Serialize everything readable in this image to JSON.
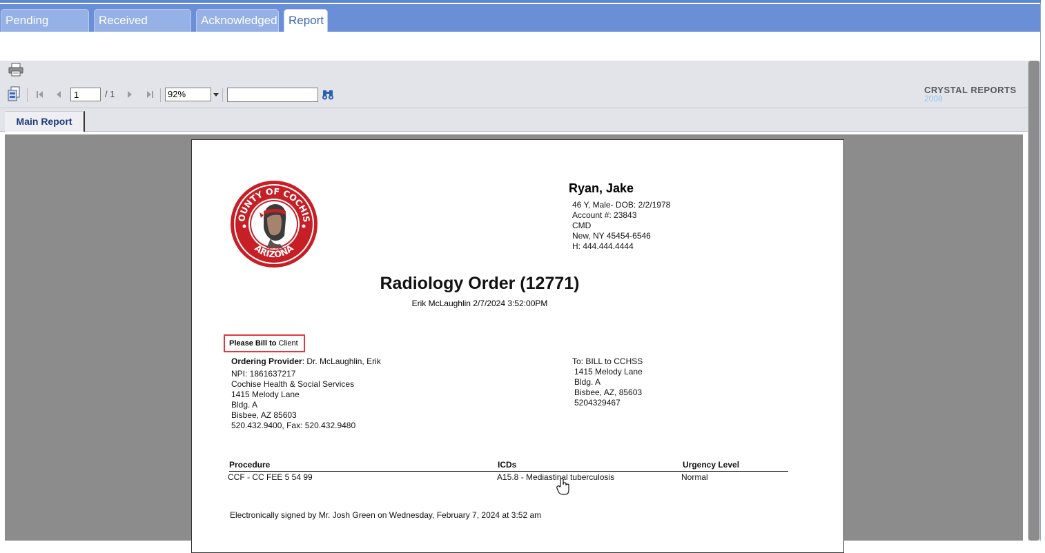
{
  "tabs": [
    {
      "label": "Pending Orders"
    },
    {
      "label": "Received Results"
    },
    {
      "label": "Acknowledged"
    },
    {
      "label": "Report"
    }
  ],
  "toolbar": {
    "page_value": "1",
    "page_total": "/ 1",
    "zoom": "92%",
    "search_value": "",
    "brand_name": "CRYSTAL REPORTS",
    "brand_year": "2008"
  },
  "report_tab": "Main Report",
  "logo_text": {
    "top": "COUNTY OF COCHISE",
    "bottom": "ARIZONA",
    "year": "1881"
  },
  "patient": {
    "name": "Ryan, Jake",
    "lines": [
      "46 Y, Male- DOB: 2/2/1978",
      "Account #: 23843",
      "CMD",
      "New,  NY 45454-6546",
      "H: 444.444.4444"
    ]
  },
  "order": {
    "title": "Radiology Order (12771)",
    "subtitle": "Erik McLaughlin 2/7/2024   3:52:00PM",
    "bill_bold": "Please Bill to",
    "bill_text": "Client"
  },
  "provider": {
    "label": "Ordering Provider",
    "name": ": Dr. McLaughlin, Erik",
    "lines": [
      "NPI: 1861637217",
      "Cochise Health & Social Services",
      "1415 Melody Lane",
      "Bldg. A",
      "Bisbee, AZ 85603",
      "520.432.9400, Fax: 520.432.9480"
    ]
  },
  "billing": {
    "to": "To: BILL to CCHSS",
    "lines": [
      "1415 Melody Lane",
      "Bldg. A",
      "Bisbee, AZ, 85603",
      "5204329467"
    ]
  },
  "table": {
    "headers": [
      "Procedure",
      "ICDs",
      "Urgency Level"
    ],
    "row": [
      "CCF - CC FEE 5 54 99",
      "A15.8 - Mediastinal tuberculosis",
      "Normal"
    ]
  },
  "signature": "Electronically signed by Mr. Josh Green on Wednesday, February 7, 2024 at  3:52 am"
}
